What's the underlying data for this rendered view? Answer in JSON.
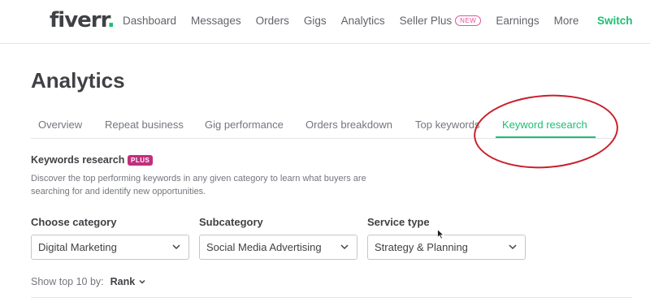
{
  "header": {
    "logo_text": "fiverr",
    "logo_dot": ".",
    "nav": [
      {
        "label": "Dashboard"
      },
      {
        "label": "Messages"
      },
      {
        "label": "Orders"
      },
      {
        "label": "Gigs"
      },
      {
        "label": "Analytics"
      },
      {
        "label": "Seller Plus",
        "badge": "NEW"
      },
      {
        "label": "Earnings"
      },
      {
        "label": "More"
      }
    ],
    "switch_label": "Switch"
  },
  "page": {
    "title": "Analytics",
    "tabs": [
      {
        "label": "Overview"
      },
      {
        "label": "Repeat business"
      },
      {
        "label": "Gig performance"
      },
      {
        "label": "Orders breakdown"
      },
      {
        "label": "Top keywords"
      },
      {
        "label": "Keyword research",
        "active": true
      }
    ]
  },
  "keywords_research": {
    "title": "Keywords research",
    "badge": "PLUS",
    "description": "Discover the top performing keywords in any given category to learn what buyers are searching for and identify new opportunities.",
    "filters": [
      {
        "label": "Choose category",
        "value": "Digital Marketing"
      },
      {
        "label": "Subcategory",
        "value": "Social Media Advertising"
      },
      {
        "label": "Service type",
        "value": "Strategy & Planning"
      }
    ],
    "show_top_label": "Show top 10 by:",
    "sort_value": "Rank"
  },
  "colors": {
    "brand_green": "#1dbf73",
    "annotation_red": "#c8202b",
    "plus_badge": "#c12e7e",
    "new_badge": "#e05599"
  },
  "icons": {
    "dropdown": "chevron-down-icon",
    "pointer": "cursor-arrow-icon"
  }
}
